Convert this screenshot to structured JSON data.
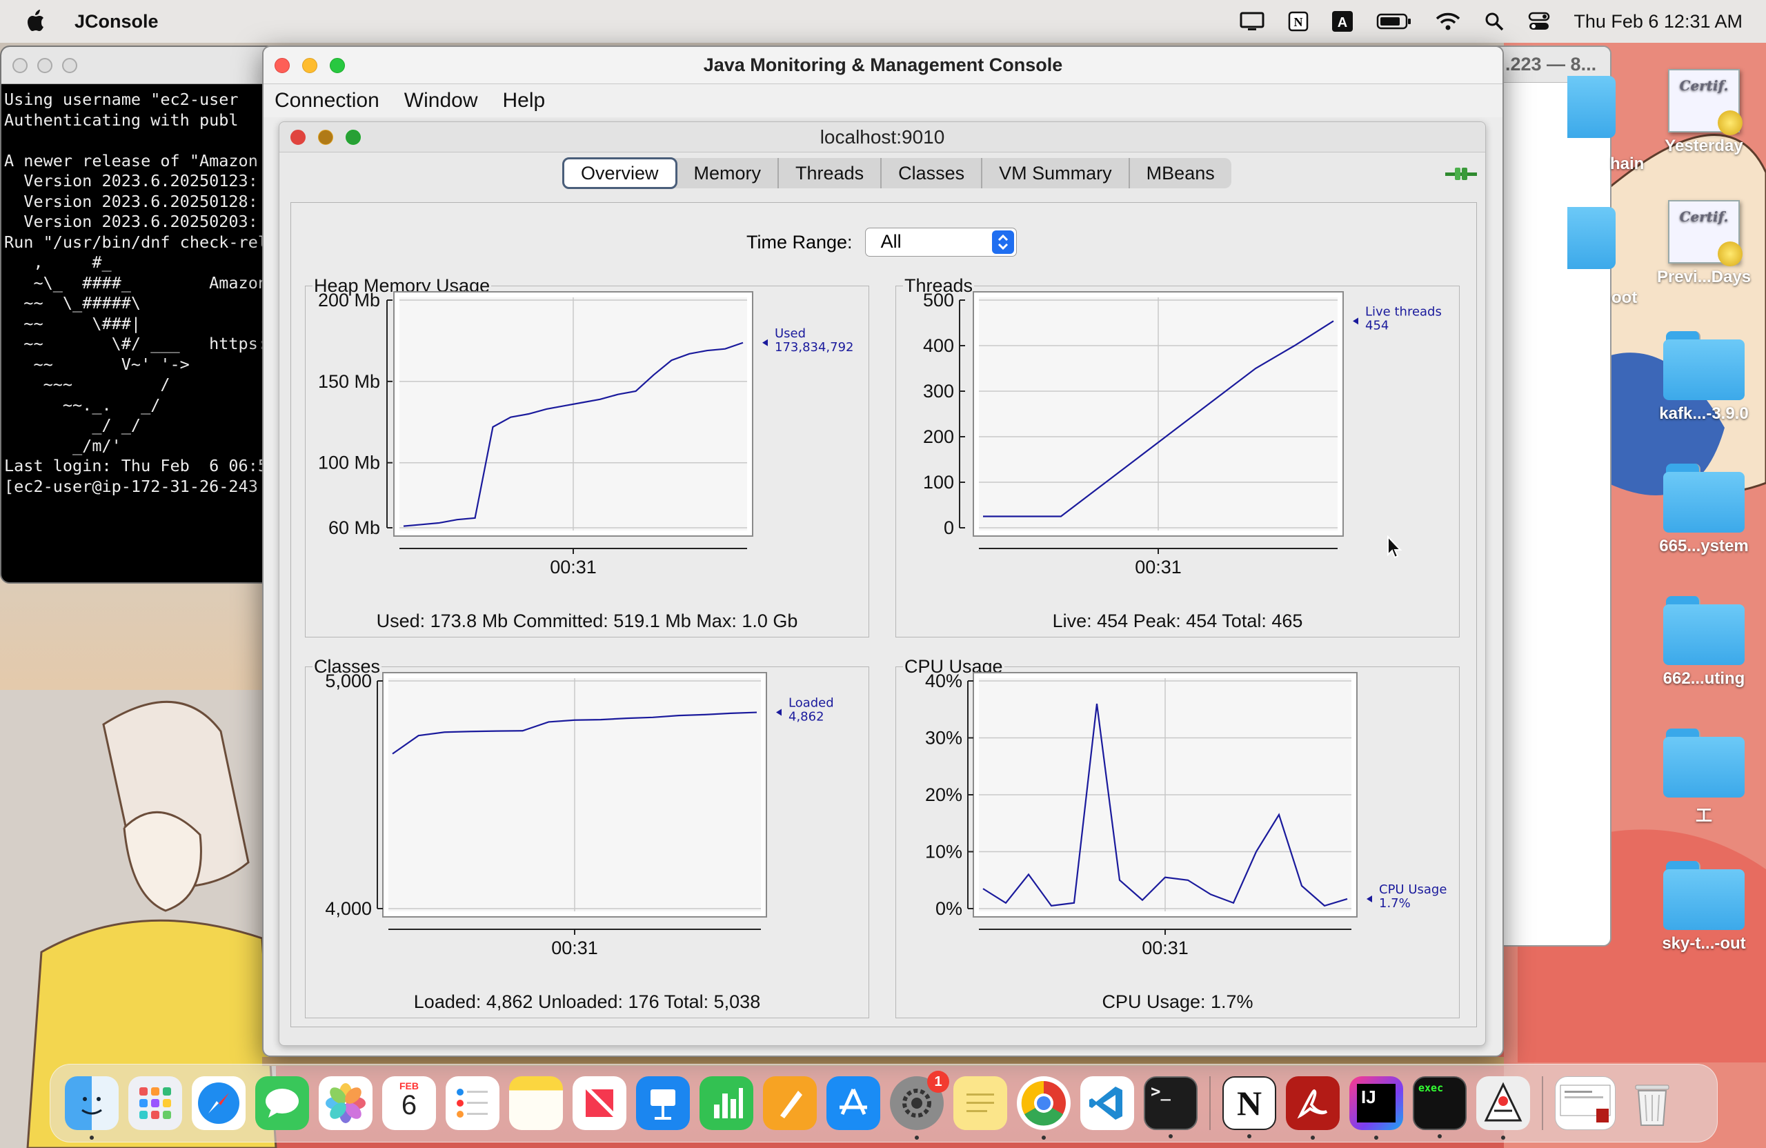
{
  "menubar": {
    "app_name": "JConsole",
    "date_time": "Thu Feb 6  12:31 AM",
    "icons": [
      "display-icon",
      "notion-menubar-icon",
      "text-input-icon",
      "battery-icon",
      "wifi-icon",
      "search-icon",
      "control-center-icon"
    ]
  },
  "terminal": {
    "lines": [
      "Using username \"ec2-user",
      "Authenticating with publ",
      "",
      "A newer release of \"Amazon",
      "  Version 2023.6.20250123:",
      "  Version 2023.6.20250128:",
      "  Version 2023.6.20250203:",
      "Run \"/usr/bin/dnf check-rel",
      "   ,     #_",
      "   ~\\_  ####_        Amazon",
      "  ~~  \\_#####\\",
      "  ~~     \\###|",
      "  ~~       \\#/ ___   https:",
      "   ~~       V~' '->",
      "    ~~~         /",
      "      ~~._.   _/",
      "         _/ _/",
      "       _/m/'",
      "Last login: Thu Feb  6 06:5",
      "[ec2-user@ip-172-31-26-243"
    ]
  },
  "back_window": {
    "title": ".223 — 8..."
  },
  "desktop": {
    "icons": [
      {
        "label": "Yesterday",
        "kind": "certificate"
      },
      {
        "label": "Previ...Days",
        "kind": "certificate"
      },
      {
        "label": "kafk...-3.9.0",
        "kind": "folder"
      },
      {
        "label": "665...ystem",
        "kind": "folder"
      },
      {
        "label": "662...uting",
        "kind": "folder"
      },
      {
        "label": "工",
        "kind": "folder"
      },
      {
        "label": "sky-t...-out",
        "kind": "folder"
      }
    ],
    "partial_labels": [
      "hain",
      "oot"
    ]
  },
  "window": {
    "title": "Java Monitoring & Management Console",
    "menus": [
      "Connection",
      "Window",
      "Help"
    ]
  },
  "connection": {
    "title": "localhost:9010",
    "tabs": [
      "Overview",
      "Memory",
      "Threads",
      "Classes",
      "VM Summary",
      "MBeans"
    ],
    "active_tab": "Overview",
    "time_range_label": "Time Range:",
    "time_range_value": "All"
  },
  "panels": {
    "heap": {
      "title": "Heap Memory Usage",
      "summary": "Used: 173.8 Mb    Committed: 519.1 Mb    Max: 1.0 Gb"
    },
    "threads": {
      "title": "Threads",
      "summary": "Live: 454    Peak: 454    Total: 465"
    },
    "classes": {
      "title": "Classes",
      "summary": "Loaded: 4,862    Unloaded: 176    Total: 5,038"
    },
    "cpu": {
      "title": "CPU Usage",
      "summary": "CPU Usage: 1.7%"
    }
  },
  "chart_data": [
    {
      "type": "line",
      "title": "Heap Memory Usage",
      "yticks": [
        "200 Mb",
        "150 Mb",
        "100 Mb",
        "60 Mb"
      ],
      "ytick_values": [
        200,
        150,
        100,
        60
      ],
      "ylim": [
        60,
        200
      ],
      "xtick": "00:31",
      "x": [
        0,
        1,
        2,
        3,
        4,
        5,
        6,
        7,
        8,
        9,
        10,
        11,
        12,
        13,
        14,
        15,
        16,
        17,
        18,
        19
      ],
      "series": [
        {
          "name": "Used",
          "values": [
            61,
            62,
            63,
            65,
            66,
            122,
            128,
            130,
            133,
            135,
            137,
            139,
            142,
            144,
            154,
            163,
            167,
            169,
            170,
            173.8
          ]
        }
      ],
      "label": {
        "name": "Used",
        "value": "173,834,792"
      }
    },
    {
      "type": "line",
      "title": "Threads",
      "yticks": [
        "500",
        "400",
        "300",
        "200",
        "100",
        "0"
      ],
      "ytick_values": [
        500,
        400,
        300,
        200,
        100,
        0
      ],
      "ylim": [
        0,
        500
      ],
      "xtick": "00:31",
      "x": [
        0,
        1,
        2,
        3,
        4,
        5,
        6,
        7,
        8,
        9
      ],
      "series": [
        {
          "name": "Live threads",
          "values": [
            25,
            25,
            25,
            90,
            155,
            220,
            285,
            350,
            400,
            454
          ]
        }
      ],
      "label": {
        "name": "Live threads",
        "value": "454"
      }
    },
    {
      "type": "line",
      "title": "Classes",
      "yticks": [
        "5,000",
        "4,000"
      ],
      "ytick_values": [
        5000,
        4000
      ],
      "ylim": [
        4000,
        5000
      ],
      "xtick": "00:31",
      "x": [
        0,
        1,
        2,
        3,
        4,
        5,
        6,
        7,
        8,
        9,
        10,
        11,
        12,
        13,
        14
      ],
      "series": [
        {
          "name": "Loaded",
          "values": [
            4680,
            4760,
            4775,
            4778,
            4780,
            4781,
            4820,
            4828,
            4830,
            4836,
            4840,
            4848,
            4852,
            4858,
            4862
          ]
        }
      ],
      "label": {
        "name": "Loaded",
        "value": "4,862"
      }
    },
    {
      "type": "line",
      "title": "CPU Usage",
      "yticks": [
        "40%",
        "30%",
        "20%",
        "10%",
        "0%"
      ],
      "ytick_values": [
        40,
        30,
        20,
        10,
        0
      ],
      "ylim": [
        0,
        40
      ],
      "xtick": "00:31",
      "x": [
        0,
        1,
        2,
        3,
        4,
        5,
        6,
        7,
        8,
        9,
        10,
        11,
        12,
        13,
        14,
        15,
        16
      ],
      "series": [
        {
          "name": "CPU Usage",
          "values": [
            3.5,
            1,
            6,
            0.5,
            1,
            36,
            5,
            1.5,
            5.5,
            5,
            2.5,
            1,
            10,
            16.5,
            4,
            0.5,
            1.7
          ]
        }
      ],
      "label": {
        "name": "CPU Usage",
        "value": "1.7%"
      }
    }
  ],
  "dock": {
    "apps": [
      "Finder",
      "Launchpad",
      "Safari",
      "Messages",
      "Photos",
      "Calendar",
      "Reminders",
      "Notes",
      "News",
      "Keynote",
      "Numbers",
      "Pages",
      "App Store",
      "System Settings",
      "Stickies",
      "Chrome",
      "VS Code",
      "Terminal",
      "Notion",
      "Acrobat",
      "IntelliJ IDEA",
      "Exec Terminal",
      "JConsole",
      "Document",
      "Trash"
    ],
    "calendar_month": "FEB",
    "calendar_day": "6",
    "settings_badge": "1",
    "intellij_label": "IJ",
    "exec_label": "exec",
    "terminal_label": ">_",
    "notion_label": "N"
  },
  "colors": {
    "series": "#1a1a9c",
    "grid": "#c8c8c8",
    "plot_bg": "#f6f6f6"
  }
}
